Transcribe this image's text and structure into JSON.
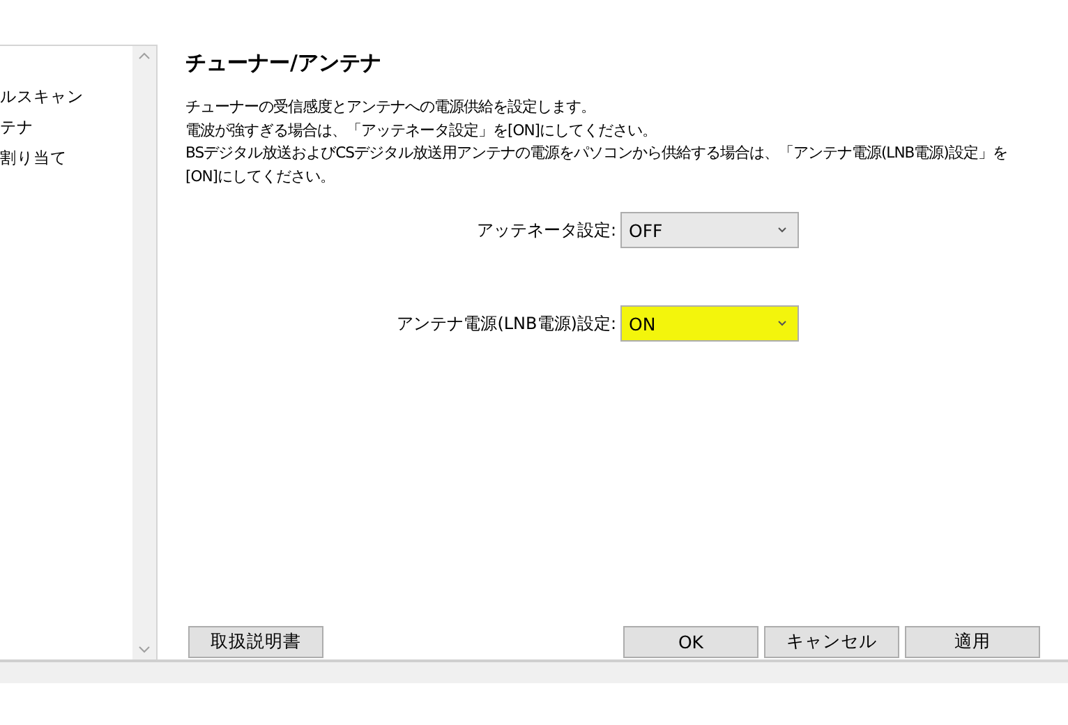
{
  "sidebar": {
    "items": [
      {
        "label": "ルスキャン"
      },
      {
        "label": "テナ"
      },
      {
        "label": "割り当て"
      }
    ]
  },
  "panel": {
    "title": "チューナー/アンテナ",
    "description": [
      "チューナーの受信感度とアンテナへの電源供給を設定します。",
      "電波が強すぎる場合は、「アッテネータ設定」を[ON]にしてください。",
      "BSデジタル放送およびCSデジタル放送用アンテナの電源をパソコンから供給する場合は、「アンテナ電源(LNB電源)設定」を[ON]にしてください。"
    ],
    "settings": [
      {
        "label": "アッテネータ設定:",
        "value": "OFF",
        "highlighted": false
      },
      {
        "label": "アンテナ電源(LNB電源)設定:",
        "value": "ON",
        "highlighted": true
      }
    ]
  },
  "buttons": {
    "manual": "取扱説明書",
    "actions": [
      "OK",
      "キャンセル",
      "適用"
    ]
  }
}
